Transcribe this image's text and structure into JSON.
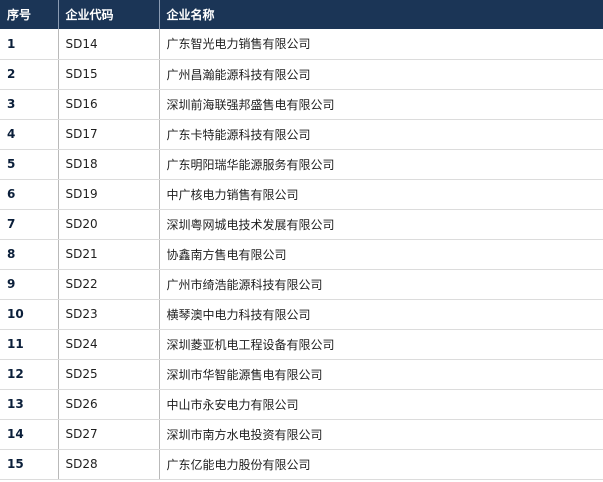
{
  "table": {
    "headers": [
      "序号",
      "企业代码",
      "企业名称"
    ],
    "rows": [
      {
        "no": "1",
        "code": "SD14",
        "name": "广东智光电力销售有限公司"
      },
      {
        "no": "2",
        "code": "SD15",
        "name": "广州昌瀚能源科技有限公司"
      },
      {
        "no": "3",
        "code": "SD16",
        "name": "深圳前海联强邦盛售电有限公司"
      },
      {
        "no": "4",
        "code": "SD17",
        "name": "广东卡特能源科技有限公司"
      },
      {
        "no": "5",
        "code": "SD18",
        "name": "广东明阳瑞华能源服务有限公司"
      },
      {
        "no": "6",
        "code": "SD19",
        "name": "中广核电力销售有限公司"
      },
      {
        "no": "7",
        "code": "SD20",
        "name": "深圳粤网城电技术发展有限公司"
      },
      {
        "no": "8",
        "code": "SD21",
        "name": "协鑫南方售电有限公司"
      },
      {
        "no": "9",
        "code": "SD22",
        "name": "广州市绮浩能源科技有限公司"
      },
      {
        "no": "10",
        "code": "SD23",
        "name": "横琴澳中电力科技有限公司"
      },
      {
        "no": "11",
        "code": "SD24",
        "name": "深圳菱亚机电工程设备有限公司"
      },
      {
        "no": "12",
        "code": "SD25",
        "name": "深圳市华智能源售电有限公司"
      },
      {
        "no": "13",
        "code": "SD26",
        "name": "中山市永安电力有限公司"
      },
      {
        "no": "14",
        "code": "SD27",
        "name": "深圳市南方水电投资有限公司"
      },
      {
        "no": "15",
        "code": "SD28",
        "name": "广东亿能电力股份有限公司"
      }
    ]
  }
}
